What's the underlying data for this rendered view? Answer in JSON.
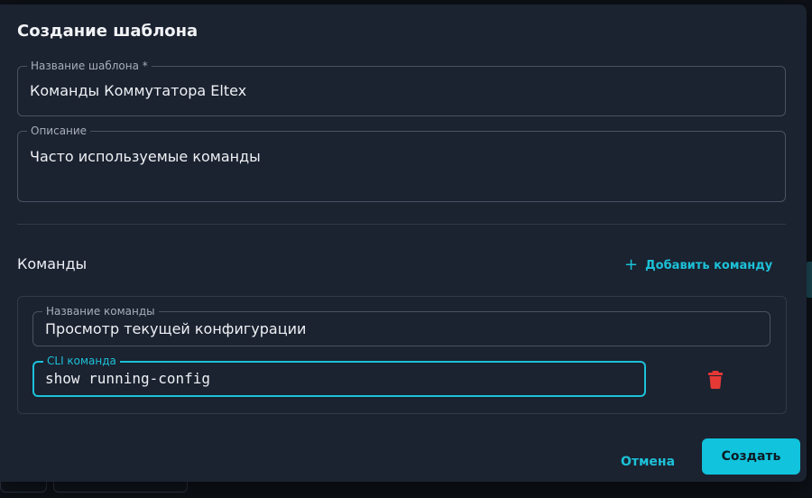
{
  "dialog": {
    "title": "Создание шаблона",
    "template_name": {
      "label": "Название шаблона *",
      "value": "Команды Коммутатора Eltex"
    },
    "description": {
      "label": "Описание",
      "value": "Часто используемые команды"
    },
    "commands_section": {
      "title": "Команды",
      "add_label": "Добавить команду"
    },
    "commands": [
      {
        "name_label": "Название команды",
        "name_value": "Просмотр текущей конфигурации",
        "cli_label": "CLI команда",
        "cli_value": "show running-config"
      }
    ],
    "buttons": {
      "cancel": "Отмена",
      "create": "Создать"
    }
  },
  "colors": {
    "accent": "#1cc1d8",
    "dialog_bg": "#1b2230",
    "delete": "#e53935"
  },
  "icons": {
    "add": "plus-icon",
    "delete": "trash-icon"
  }
}
